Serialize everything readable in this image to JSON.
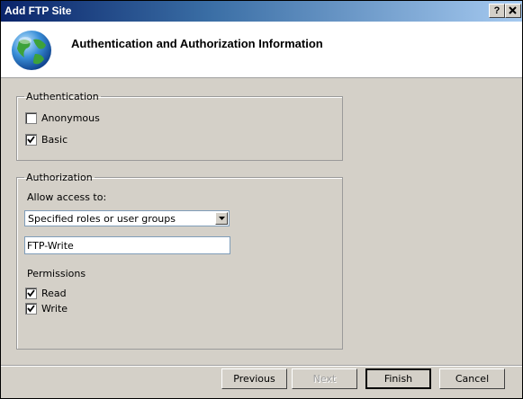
{
  "window": {
    "title": "Add FTP Site",
    "help_label": "?",
    "close_label": "X"
  },
  "header": {
    "title": "Authentication and Authorization Information",
    "icon": "globe-icon"
  },
  "authentication": {
    "legend": "Authentication",
    "anonymous": {
      "label": "Anonymous",
      "checked": false
    },
    "basic": {
      "label": "Basic",
      "checked": true
    }
  },
  "authorization": {
    "legend": "Authorization",
    "allow_access_label": "Allow access to:",
    "allow_access_value": "Specified roles or user groups",
    "roles_value": "FTP-Write",
    "permissions_label": "Permissions",
    "read": {
      "label": "Read",
      "checked": true
    },
    "write": {
      "label": "Write",
      "checked": true
    }
  },
  "buttons": {
    "previous": "Previous",
    "next": "Next",
    "finish": "Finish",
    "cancel": "Cancel"
  }
}
